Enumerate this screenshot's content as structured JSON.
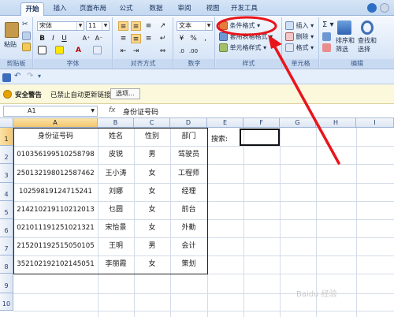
{
  "tabs": [
    "开始",
    "插入",
    "页面布局",
    "公式",
    "数据",
    "审阅",
    "视图",
    "开发工具"
  ],
  "ribbon": {
    "paste_label": "粘贴",
    "clipboard_label": "剪贴板",
    "font_name": "宋体",
    "font_size": "11",
    "font_group_label": "字体",
    "align_group_label": "对齐方式",
    "number_format": "文本",
    "number_group_label": "数字",
    "cond_format_label": "条件格式",
    "table_format_label": "套用表格格式",
    "cell_style_label": "单元格样式",
    "styles_group_label": "样式",
    "insert_label": "插入",
    "delete_label": "删除",
    "format_label": "格式",
    "cells_group_label": "单元格",
    "sort_label": "排序和",
    "filter_label": "筛选",
    "find_label": "查找和",
    "select_label": "选择",
    "edit_group_label": "编辑"
  },
  "security": {
    "label": "安全警告",
    "message": "已禁止自动更新链接",
    "options_button": "选项..."
  },
  "formula_bar": {
    "name_box": "A1",
    "fx": "fx",
    "content": "身份证号码"
  },
  "columns": [
    "A",
    "B",
    "C",
    "D",
    "E",
    "F",
    "G",
    "H",
    "I"
  ],
  "rows": [
    "1",
    "2",
    "3",
    "4",
    "5",
    "6",
    "7",
    "8",
    "9",
    "10"
  ],
  "table": {
    "header": [
      "身份证号码",
      "姓名",
      "性别",
      "部门"
    ],
    "rows": [
      [
        "010356199510258798",
        "皮锐",
        "男",
        "驾驶员"
      ],
      [
        "250132198012587462",
        "王小涛",
        "女",
        "工程师"
      ],
      [
        "10259819124715241",
        "刘娜",
        "女",
        "经理"
      ],
      [
        "214210219110212013",
        "乜圆",
        "女",
        "前台"
      ],
      [
        "021011191251021321",
        "宋怡景",
        "女",
        "外勤"
      ],
      [
        "215201192515050105",
        "王明",
        "男",
        "会计"
      ],
      [
        "352102192102145051",
        "李丽霞",
        "女",
        "策划"
      ]
    ]
  },
  "search_label": "搜索:",
  "watermark": "Baidu 经验"
}
